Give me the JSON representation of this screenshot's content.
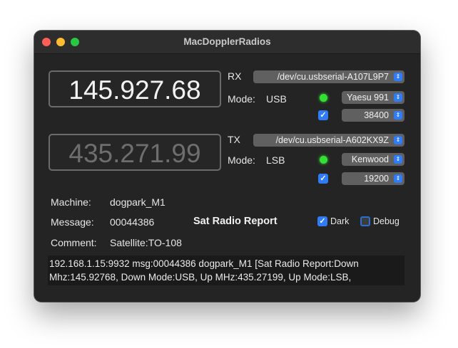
{
  "window": {
    "title": "MacDopplerRadios"
  },
  "rx": {
    "frequency": "145.927.68",
    "label": "RX",
    "port": "/dev/cu.usbserial-A107L9P7",
    "mode_label": "Mode:",
    "mode": "USB",
    "radio": "Yaesu 991",
    "baud": "38400"
  },
  "tx": {
    "frequency": "435.271.99",
    "label": "TX",
    "port": "/dev/cu.usbserial-A602KX9Z",
    "mode_label": "Mode:",
    "mode": "LSB",
    "radio": "Kenwood",
    "baud": "19200"
  },
  "info": {
    "machine_label": "Machine:",
    "machine_value": "dogpark_M1",
    "message_label": "Message:",
    "message_value": "00044386",
    "comment_label": "Comment:",
    "comment_value": "Satellite:TO-108",
    "report_title": "Sat Radio Report"
  },
  "options": {
    "dark_label": "Dark",
    "dark_checked": true,
    "debug_label": "Debug",
    "debug_checked": false
  },
  "log": {
    "line1": "192.168.1.15:9932 msg:00044386 dogpark_M1 [Sat Radio Report:Down",
    "line2": "Mhz:145.92768, Down Mode:USB, Up MHz:435.27199, Up Mode:LSB,"
  },
  "colors": {
    "accent": "#2f7cf6",
    "led_on": "#33e033",
    "window_bg": "#242424"
  },
  "icons": {
    "chevron": "updown-chevron-icon",
    "check": "checkmark-icon"
  }
}
